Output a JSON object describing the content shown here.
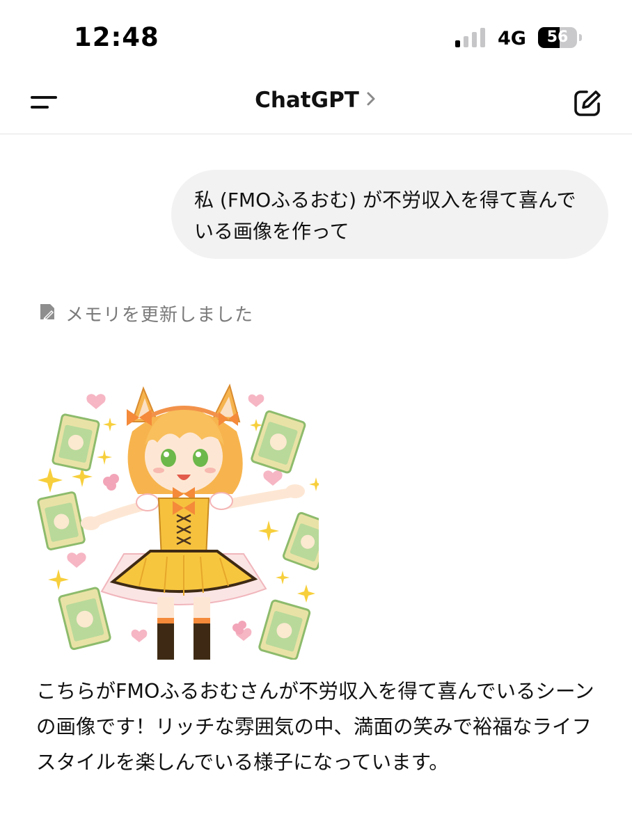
{
  "status_bar": {
    "time": "12:48",
    "network": "4G",
    "battery_percent": "56",
    "signal_bars_active": 1,
    "signal_bars_total": 4
  },
  "nav": {
    "title": "ChatGPT",
    "menu_icon": "menu-icon",
    "chevron_icon": "chevron-right-icon",
    "edit_icon": "new-chat-edit-icon"
  },
  "conversation": {
    "user_message": "私 (FMOふるおむ) が不労収入を得て喜んでいる画像を作って",
    "memory_notice": "メモリを更新しました",
    "assistant_reply": "こちらがFMOふるおむさんが不労収入を得て喜んでいるシーンの画像です！リッチな雰囲気の中、満面の笑みで裕福なライフスタイルを楽しんでいる様子になっています。"
  },
  "colors": {
    "bubble_bg": "#f2f2f2",
    "muted_text": "#7a7a7a",
    "card_green": "#7fb069",
    "dress_yellow": "#f6c23e",
    "hair_orange": "#f3a94a"
  }
}
